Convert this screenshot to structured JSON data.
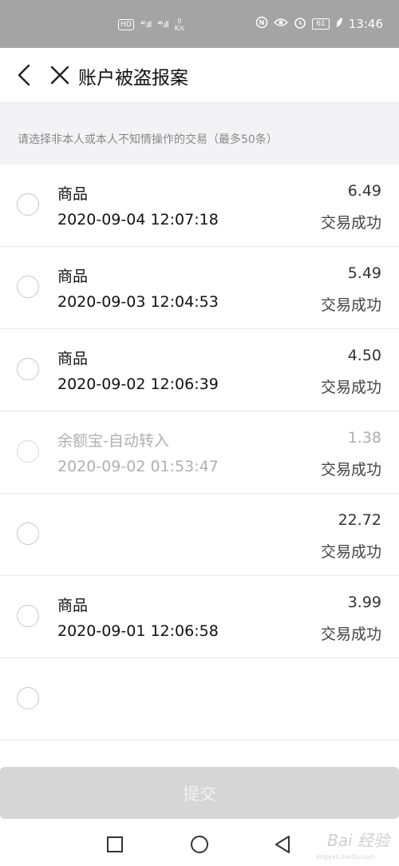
{
  "status_bar": {
    "hd": "HD",
    "signal1": "⁴⁶.ıll",
    "signal2": "⁴⁶.ıll",
    "speed_value": "0",
    "speed_unit": "K/s",
    "battery": "61",
    "time": "13:46"
  },
  "header": {
    "title": "账户被盗报案"
  },
  "hint": {
    "text": "请选择非本人或本人不知情操作的交易（最多50条）"
  },
  "transactions": [
    {
      "name": "商品",
      "date": "2020-09-04 12:07:18",
      "amount": "6.49",
      "status": "交易成功"
    },
    {
      "name": "商品",
      "date": "2020-09-03 12:04:53",
      "amount": "5.49",
      "status": "交易成功"
    },
    {
      "name": "商品",
      "date": "2020-09-02 12:06:39",
      "amount": "4.50",
      "status": "交易成功"
    },
    {
      "name": "余额宝-自动转入",
      "date": "2020-09-02 01:53:47",
      "amount": "1.38",
      "status": "交易成功"
    },
    {
      "name": "",
      "date": "",
      "amount": "22.72",
      "status": "交易成功"
    },
    {
      "name": "商品",
      "date": "2020-09-01 12:06:58",
      "amount": "3.99",
      "status": "交易成功"
    },
    {
      "name": "",
      "date": "",
      "amount": "",
      "status": ""
    }
  ],
  "submit": {
    "label": "提交"
  },
  "watermark": {
    "text": "Bai 经验",
    "sub": "jingyan.baidu.com"
  }
}
